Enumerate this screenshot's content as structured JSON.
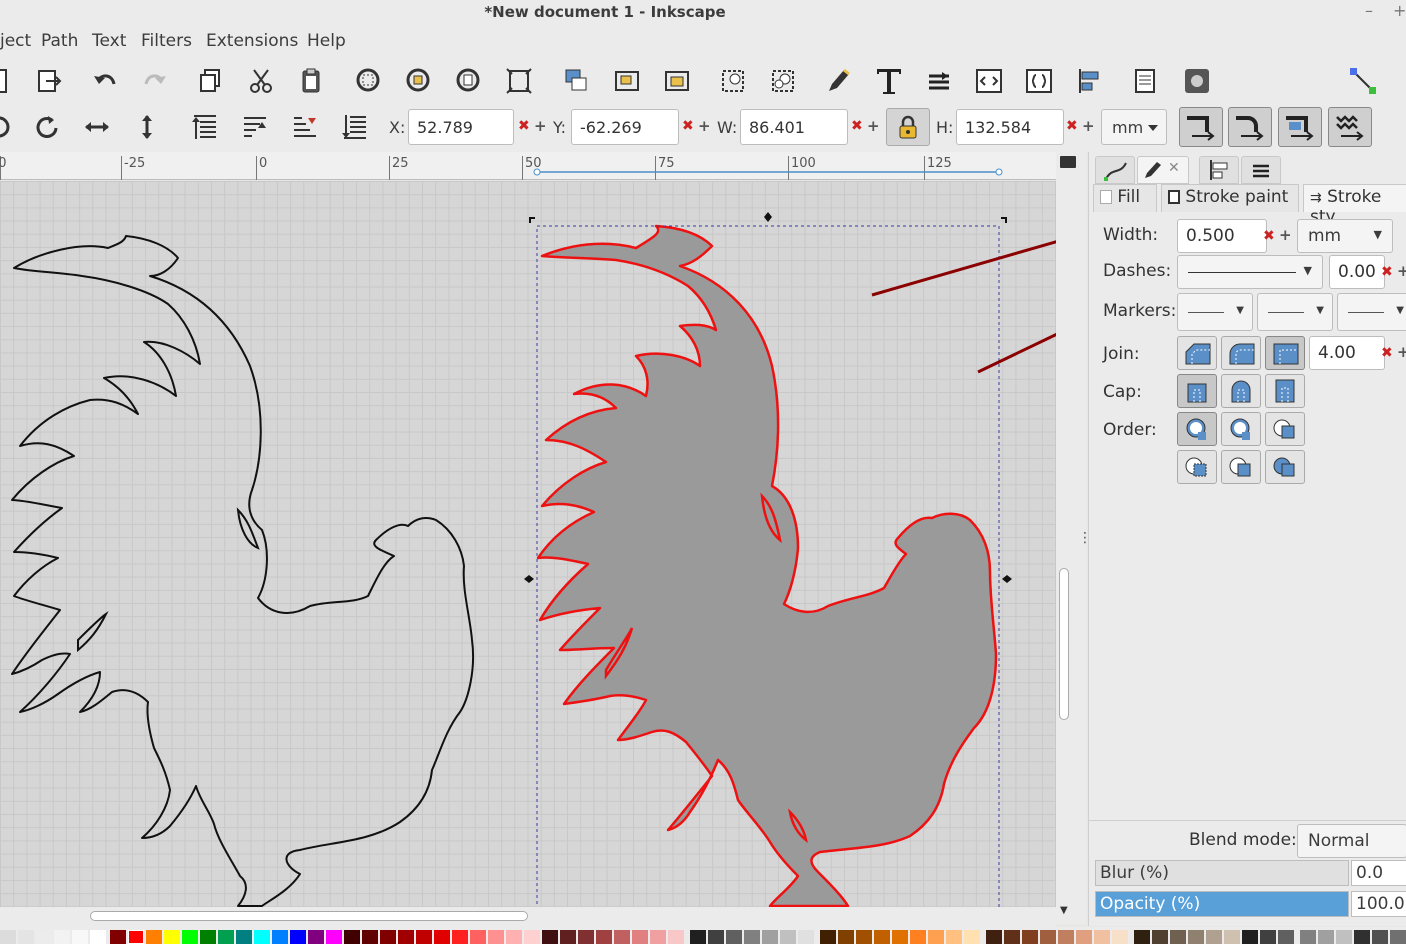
{
  "window": {
    "title": "*New document 1 - Inkscape",
    "min_symbol": "–",
    "max_symbol": "+"
  },
  "menu": [
    {
      "label": "ject"
    },
    {
      "label": "Path"
    },
    {
      "label": "Text"
    },
    {
      "label": "Filters"
    },
    {
      "label": "Extensions"
    },
    {
      "label": "Help"
    }
  ],
  "toolbar": {
    "x_label": "X:",
    "x_value": "52.789",
    "y_label": "Y:",
    "y_value": "-62.269",
    "w_label": "W:",
    "w_value": "86.401",
    "h_label": "H:",
    "h_value": "132.584",
    "unit": "mm",
    "clear_symbol": "✖",
    "plus_symbol": "+"
  },
  "ruler": {
    "labels": [
      "50",
      "-25",
      "0",
      "25",
      "50",
      "75",
      "100",
      "125"
    ]
  },
  "panel": {
    "subtabs": {
      "fill": "Fill",
      "stroke_paint": "Stroke paint",
      "stroke_style": "Stroke sty"
    },
    "width_label": "Width:",
    "width_value": "0.500",
    "width_unit": "mm",
    "dashes_label": "Dashes:",
    "dashes_value": "0.00",
    "markers_label": "Markers:",
    "join_label": "Join:",
    "join_value": "4.00",
    "cap_label": "Cap:",
    "order_label": "Order:",
    "blend_label": "Blend mode:",
    "blend_value": "Normal",
    "blur_label": "Blur (%)",
    "blur_value": "0.0",
    "opacity_label": "Opacity (%)",
    "opacity_value": "100.0"
  },
  "colors": {
    "selected_stroke": "#ff0000",
    "accent": "#5aa0d8",
    "annotation_arrow": "#8b0000"
  }
}
